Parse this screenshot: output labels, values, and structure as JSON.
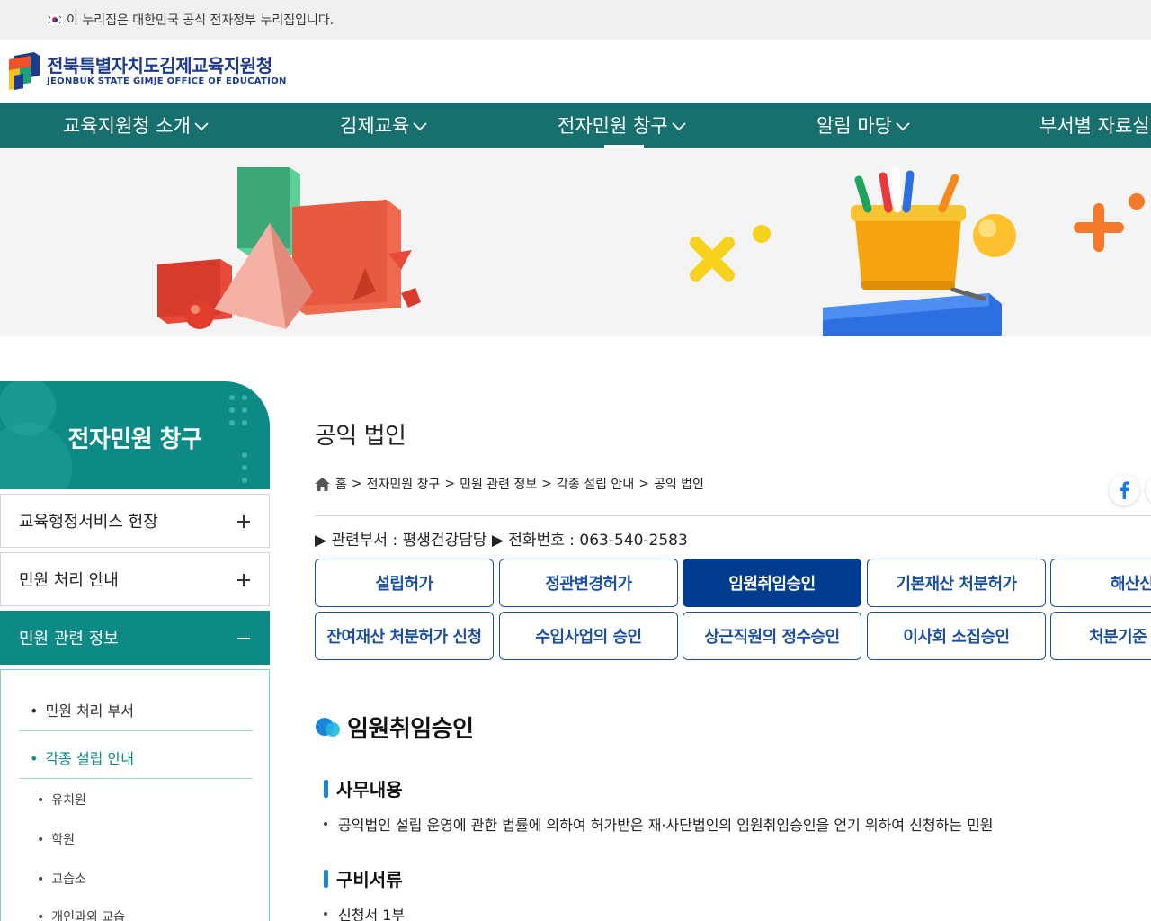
{
  "gov_notice": "이 누리집은 대한민국 공식 전자정부 누리집입니다.",
  "logo": {
    "name_ko": "전북특별자치도김제교육지원청",
    "name_en": "JEONBUK STATE GIMJE OFFICE OF EDUCATION"
  },
  "gnb": [
    {
      "label": "교육지원청 소개"
    },
    {
      "label": "김제교육"
    },
    {
      "label": "전자민원 창구"
    },
    {
      "label": "알림 마당"
    },
    {
      "label": "부서별 자료실"
    }
  ],
  "sidebar": {
    "title": "전자민원 창구",
    "menus": [
      {
        "label": "교육행정서비스 헌장"
      },
      {
        "label": "민원 처리 안내"
      },
      {
        "label": "민원 관련 정보"
      }
    ],
    "sub_items": [
      {
        "label": "민원 처리 부서"
      },
      {
        "label": "각종 설립 안내"
      }
    ],
    "sub3_items": [
      {
        "label": "유치원"
      },
      {
        "label": "학원"
      },
      {
        "label": "교습소"
      },
      {
        "label": "개인과외 교습"
      }
    ]
  },
  "page": {
    "title": "공익 법인",
    "breadcrumb": [
      "홈",
      "전자민원 창구",
      "민원 관련 정보",
      "각종 설립 안내",
      "공익 법인"
    ],
    "dept_line": "▶ 관련부서 : 평생건강담당 ▶ 전화번호 : 063-540-2583"
  },
  "tabs_row1": [
    {
      "label": "설립허가"
    },
    {
      "label": "정관변경허가"
    },
    {
      "label": "임원취임승인"
    },
    {
      "label": "기본재산 처분허가"
    },
    {
      "label": "해산신고"
    }
  ],
  "tabs_row2": [
    {
      "label": "잔여재산 처분허가 신청"
    },
    {
      "label": "수입사업의 승인"
    },
    {
      "label": "상근직원의 정수승인"
    },
    {
      "label": "이사회 소집승인"
    },
    {
      "label": "처분기준"
    }
  ],
  "content": {
    "section_title": "임원취임승인",
    "h1": "사무내용",
    "p1": "공익법인 설립 운영에 관한 법률에 의하여 허가받은 재·사단법인의 임원취임승인을 얻기 위하여 신청하는 민원",
    "h2": "구비서류",
    "p2": "신청서 1부"
  },
  "colors": {
    "gnb_bg": "#17706d",
    "sidebar_accent": "#0e8a86",
    "tab_border": "#1d4fa0",
    "tab_active": "#003d8f",
    "logo_text": "#1d3b8c"
  }
}
